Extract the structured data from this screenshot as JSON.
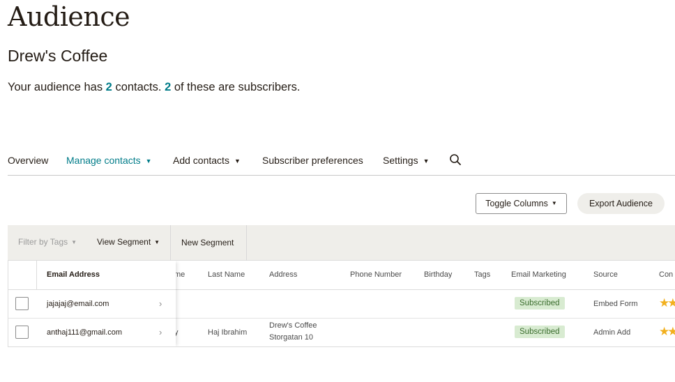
{
  "page": {
    "title": "Audience",
    "audience_name": "Drew's Coffee"
  },
  "summary": {
    "prefix": "Your audience has ",
    "contacts_count": "2",
    "middle": " contacts. ",
    "subscribers_count": "2",
    "suffix": " of these are subscribers."
  },
  "nav": {
    "items": [
      {
        "label": "Overview",
        "has_dropdown": false,
        "active": false
      },
      {
        "label": "Manage contacts",
        "has_dropdown": true,
        "active": true
      },
      {
        "label": "Add contacts",
        "has_dropdown": true,
        "active": false
      },
      {
        "label": "Subscriber preferences",
        "has_dropdown": false,
        "active": false
      },
      {
        "label": "Settings",
        "has_dropdown": true,
        "active": false
      }
    ],
    "search_icon": "search-icon"
  },
  "toolbar": {
    "toggle_columns_label": "Toggle Columns",
    "export_label": "Export Audience"
  },
  "filters": {
    "filter_tags_label": "Filter by Tags",
    "view_segment_label": "View Segment",
    "new_segment_label": "New Segment"
  },
  "table": {
    "email_header": "Email Address",
    "columns": [
      "me",
      "Last Name",
      "Address",
      "Phone Number",
      "Birthday",
      "Tags",
      "Email Marketing",
      "Source",
      "Con"
    ],
    "rows": [
      {
        "email": "jajajaj@email.com",
        "first_name_partial": "",
        "last_name": "",
        "address_line1": "",
        "address_line2": "",
        "phone": "",
        "birthday": "",
        "tags": "",
        "email_marketing": "Subscribed",
        "source": "Embed Form",
        "rating_icon": "star-icon"
      },
      {
        "email": "anthaj111@gmail.com",
        "first_name_partial": "y",
        "last_name": "Haj Ibrahim",
        "address_line1": "Drew's Coffee",
        "address_line2": "Storgatan 10",
        "phone": "",
        "birthday": "",
        "tags": "",
        "email_marketing": "Subscribed",
        "source": "Admin Add",
        "rating_icon": "star-icon"
      }
    ]
  },
  "colors": {
    "accent": "#007c89",
    "badge_bg": "#d8ebd1",
    "badge_text": "#3b6d2e",
    "star": "#f2b01e",
    "filter_bg": "#efeeea"
  }
}
